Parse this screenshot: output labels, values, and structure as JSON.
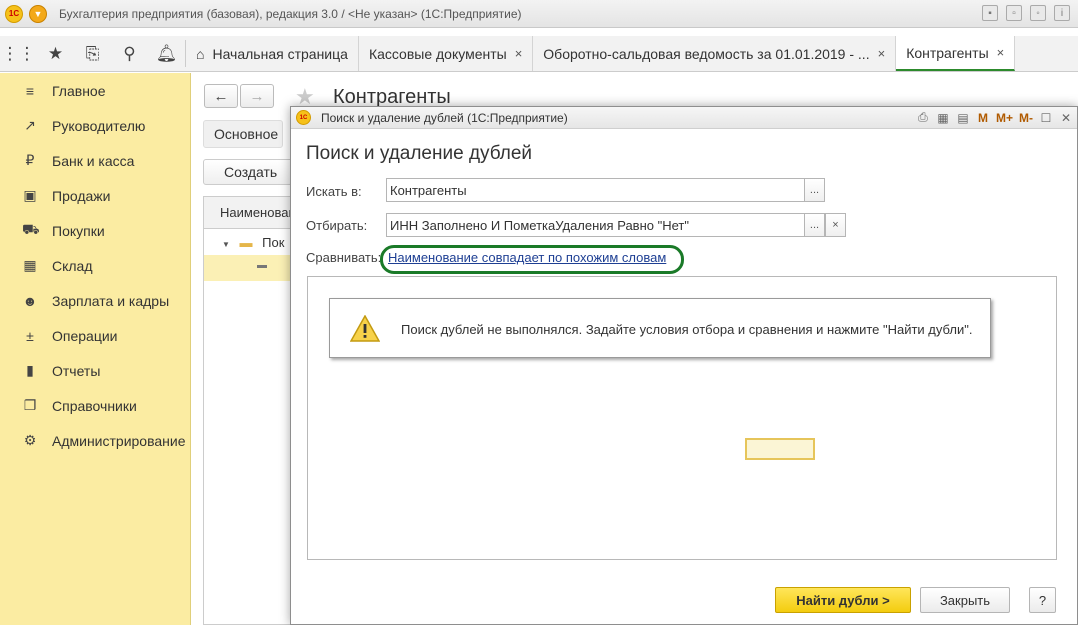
{
  "app": {
    "title": "Бухгалтерия предприятия (базовая), редакция 3.0 / <Не указан>  (1С:Предприятие)",
    "logo_text": "1С"
  },
  "tabs": [
    {
      "label": "Начальная страница",
      "closable": false
    },
    {
      "label": "Кассовые документы",
      "closable": true
    },
    {
      "label": "Оборотно-сальдовая ведомость за 01.01.2019 - ...",
      "closable": true
    },
    {
      "label": "Контрагенты",
      "closable": true,
      "active": true
    }
  ],
  "tab_close_glyph": "×",
  "sidebar": {
    "items": [
      {
        "label": "Главное",
        "icon": "menu-lines-icon"
      },
      {
        "label": "Руководителю",
        "icon": "trend-icon"
      },
      {
        "label": "Банк и касса",
        "icon": "ruble-icon"
      },
      {
        "label": "Продажи",
        "icon": "bag-icon"
      },
      {
        "label": "Покупки",
        "icon": "cart-icon"
      },
      {
        "label": "Склад",
        "icon": "warehouse-grid-icon"
      },
      {
        "label": "Зарплата и кадры",
        "icon": "person-icon"
      },
      {
        "label": "Операции",
        "icon": "debit-credit-icon"
      },
      {
        "label": "Отчеты",
        "icon": "bar-chart-icon"
      },
      {
        "label": "Справочники",
        "icon": "books-icon"
      },
      {
        "label": "Администрирование",
        "icon": "gear-icon"
      }
    ]
  },
  "background_form": {
    "title": "Контрагенты",
    "main_button": "Основное",
    "create_button": "Создать",
    "column_header": "Наименование",
    "row_label": "Пок"
  },
  "dialog": {
    "window_title": "Поиск и удаление дублей  (1С:Предприятие)",
    "heading": "Поиск и удаление дублей",
    "search_in": {
      "label": "Искать в:",
      "value": "Контрагенты"
    },
    "filter": {
      "label": "Отбирать:",
      "value": "ИНН Заполнено И ПометкаУдаления Равно \"Нет\""
    },
    "compare": {
      "label": "Сравнивать:",
      "link": "Наименование совпадает по похожим словам"
    },
    "message": "Поиск дублей не выполнялся.  Задайте условия отбора и сравнения и нажмите \"Найти дубли\".",
    "find_button": "Найти дубли >",
    "close_button": "Закрыть",
    "help_button": "?",
    "ellipsis": "...",
    "clear": "×",
    "toolbar": {
      "m": "M",
      "m_plus": "M+",
      "m_minus": "M-"
    }
  },
  "colors": {
    "sidebar_bg": "#fbeca2",
    "accent_green": "#1a7a28",
    "primary_button": "#f3cc0f",
    "link": "#1e3f93"
  }
}
